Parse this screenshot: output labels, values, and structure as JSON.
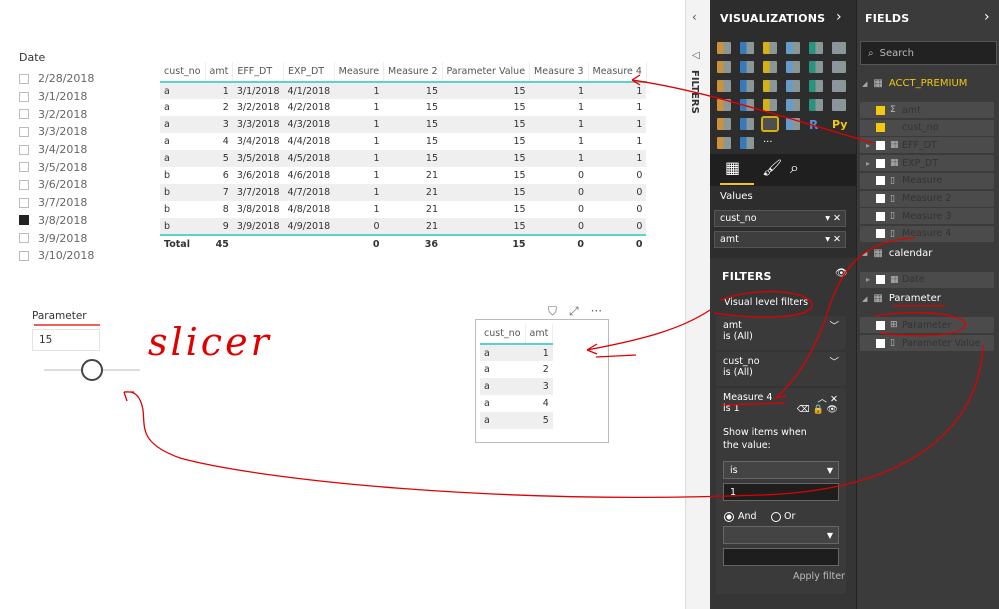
{
  "date_slicer": {
    "title": "Date",
    "items": [
      {
        "label": "2/28/2018",
        "checked": false
      },
      {
        "label": "3/1/2018",
        "checked": false
      },
      {
        "label": "3/2/2018",
        "checked": false
      },
      {
        "label": "3/3/2018",
        "checked": false
      },
      {
        "label": "3/4/2018",
        "checked": false
      },
      {
        "label": "3/5/2018",
        "checked": false
      },
      {
        "label": "3/6/2018",
        "checked": false
      },
      {
        "label": "3/7/2018",
        "checked": false
      },
      {
        "label": "3/8/2018",
        "checked": true
      },
      {
        "label": "3/9/2018",
        "checked": false
      },
      {
        "label": "3/10/2018",
        "checked": false
      }
    ]
  },
  "main_table": {
    "columns": [
      "cust_no",
      "amt",
      "EFF_DT",
      "EXP_DT",
      "Measure",
      "Measure 2",
      "Parameter Value",
      "Measure 3",
      "Measure 4"
    ],
    "rows": [
      [
        "a",
        "1",
        "3/1/2018",
        "4/1/2018",
        "1",
        "15",
        "15",
        "1",
        "1"
      ],
      [
        "a",
        "2",
        "3/2/2018",
        "4/2/2018",
        "1",
        "15",
        "15",
        "1",
        "1"
      ],
      [
        "a",
        "3",
        "3/3/2018",
        "4/3/2018",
        "1",
        "15",
        "15",
        "1",
        "1"
      ],
      [
        "a",
        "4",
        "3/4/2018",
        "4/4/2018",
        "1",
        "15",
        "15",
        "1",
        "1"
      ],
      [
        "a",
        "5",
        "3/5/2018",
        "4/5/2018",
        "1",
        "15",
        "15",
        "1",
        "1"
      ],
      [
        "b",
        "6",
        "3/6/2018",
        "4/6/2018",
        "1",
        "21",
        "15",
        "0",
        "0"
      ],
      [
        "b",
        "7",
        "3/7/2018",
        "4/7/2018",
        "1",
        "21",
        "15",
        "0",
        "0"
      ],
      [
        "b",
        "8",
        "3/8/2018",
        "4/8/2018",
        "1",
        "21",
        "15",
        "0",
        "0"
      ],
      [
        "b",
        "9",
        "3/9/2018",
        "4/9/2018",
        "0",
        "21",
        "15",
        "0",
        "0"
      ]
    ],
    "total": [
      "Total",
      "45",
      "",
      "",
      "0",
      "36",
      "15",
      "0",
      "0"
    ]
  },
  "parameter_slicer": {
    "title": "Parameter",
    "value": "15",
    "slider_percent": 50
  },
  "annotation": {
    "text": "slicer",
    "color": "#e00000"
  },
  "small_table": {
    "columns": [
      "cust_no",
      "amt"
    ],
    "rows": [
      [
        "a",
        "1"
      ],
      [
        "a",
        "2"
      ],
      [
        "a",
        "3"
      ],
      [
        "a",
        "4"
      ],
      [
        "a",
        "5"
      ]
    ]
  },
  "filters_strip": {
    "label": "FILTERS"
  },
  "visualizations": {
    "title": "VISUALIZATIONS",
    "values_label": "Values",
    "values": [
      "cust_no",
      "amt"
    ],
    "icon_colors": [
      "#e8a33d",
      "#3a86d4",
      "#f2c811",
      "#6fb0e8",
      "#2aa58d",
      "#9fa7b3"
    ]
  },
  "filters": {
    "title": "FILTERS",
    "section": "Visual level filters",
    "cards": [
      {
        "field": "amt",
        "state": "is (All)"
      },
      {
        "field": "cust_no",
        "state": "is (All)"
      }
    ],
    "active": {
      "field": "Measure 4",
      "state": "is 1",
      "show_label": "Show items when the value:",
      "operator": "is",
      "value": "1",
      "and_label": "And",
      "or_label": "Or",
      "logic": "And",
      "apply_label": "Apply filter"
    }
  },
  "fields": {
    "title": "FIELDS",
    "search_placeholder": "Search",
    "accent": "#f2c811",
    "tables": [
      {
        "name": "ACCT_PREMIUM",
        "items": [
          {
            "label": "amt",
            "checked": true,
            "icon": "sigma-icon"
          },
          {
            "label": "cust_no",
            "checked": true,
            "icon": ""
          },
          {
            "label": "EFF_DT",
            "checked": false,
            "icon": "calendar-icon"
          },
          {
            "label": "EXP_DT",
            "checked": false,
            "icon": "calendar-icon"
          },
          {
            "label": "Measure",
            "checked": false,
            "icon": "calculator-icon"
          },
          {
            "label": "Measure 2",
            "checked": false,
            "icon": "calculator-icon"
          },
          {
            "label": "Measure 3",
            "checked": false,
            "icon": "calculator-icon"
          },
          {
            "label": "Measure 4",
            "checked": false,
            "icon": "calculator-icon"
          }
        ]
      },
      {
        "name": "calendar",
        "items": [
          {
            "label": "Date",
            "checked": false,
            "icon": "calendar-icon"
          }
        ]
      },
      {
        "name": "Parameter",
        "items": [
          {
            "label": "Parameter",
            "checked": false,
            "icon": "parameter-icon"
          },
          {
            "label": "Parameter Value",
            "checked": false,
            "icon": "calculator-icon"
          }
        ]
      }
    ]
  }
}
